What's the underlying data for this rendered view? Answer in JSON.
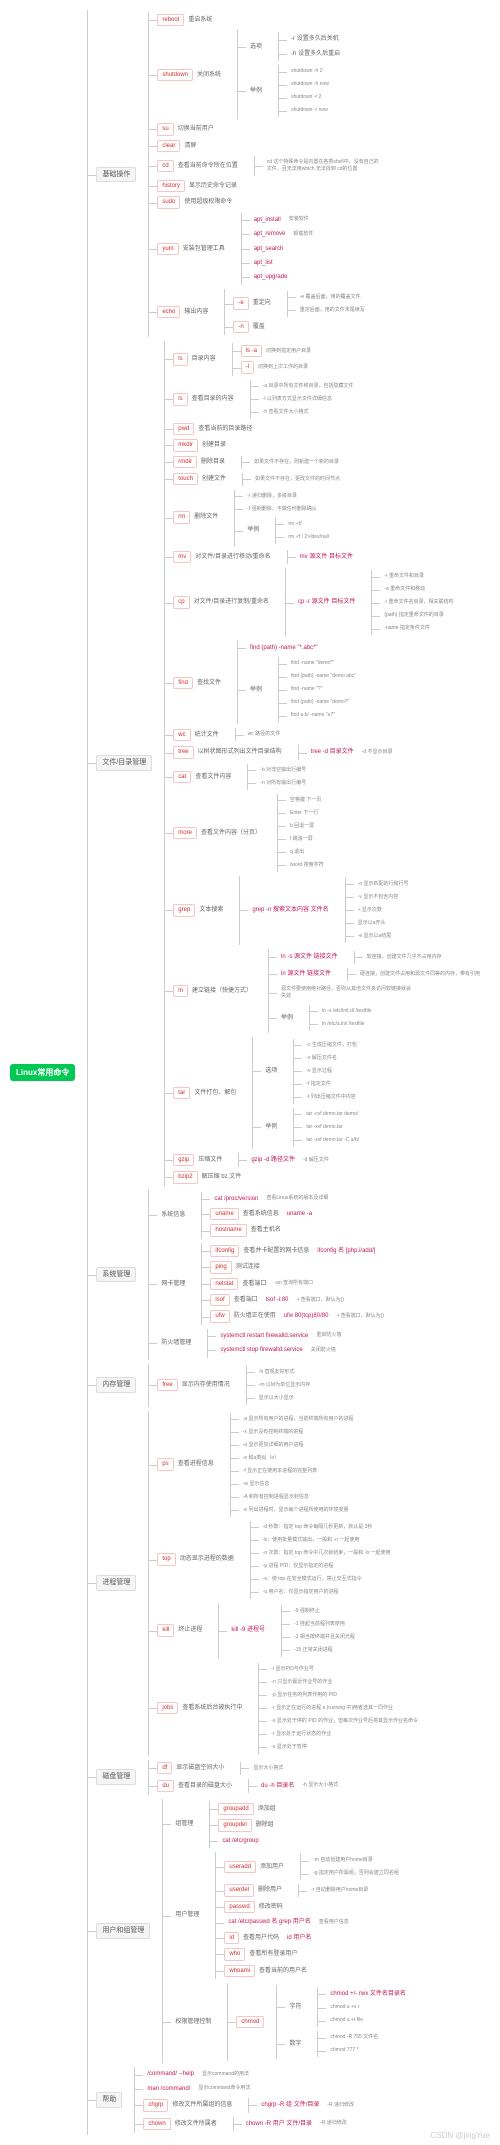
{
  "root": "Linux常用命令",
  "watermark": "CSDN @jingYue.",
  "t": {
    "basic": "基础操作",
    "reboot": "reboot",
    "reboot_d": "重启系统",
    "shutdown": "shutdown",
    "shutdown_d": "关闭系统",
    "shutdown_opt": "选项",
    "shutdown_r": "-r 设置多久后关机",
    "shutdown_h": "-h 设置多久后重启",
    "shutdown_ex": "举例",
    "ex1": "shutdown -h 2",
    "ex2": "shutdown -h now",
    "ex3": "shutdown -r 2",
    "ex4": "shutdown -r now",
    "su": "su",
    "su_d": "切换当前用户",
    "clear": "clear",
    "clear_d": "清屏",
    "cd": "cd",
    "cd_d": "查看当前命令所在位置",
    "cd_note": "cd 这个特殊命令是内置在各类shell中，没有自己的文件，且无法用which 无法找到 cd的位置",
    "history": "history",
    "history_d": "显示历史命令记录",
    "sudo": "sudo",
    "sudo_d": "使用超级权限命令",
    "yum": "yum",
    "yum_d": "安装包管理工具",
    "yum1": "apt_install",
    "yum1_d": "安装软件",
    "yum2": "apt_remove",
    "yum2_d": "卸载软件",
    "yum3": "apt_search",
    "yum4": "apt_list",
    "yum5": "apt_upgrade",
    "echo": "echo",
    "echo_d": "输出内容",
    "echo_opt1": "-e",
    "echo_opt1_d": "重定向",
    "echo_opt2": "-n",
    "echo_opt2_d": "覆盖",
    "echo_note1": "-e 覆盖后面，用的覆盖文件",
    "echo_note2": "重定后面，用的文件末尾续写",
    "file": "文件/目录管理",
    "ls": "ls",
    "ls_d": "目录内容",
    "ls_a": "ls -a",
    "ls_a_d": "切换到指定用户目录",
    "ls_l": "-l",
    "ls_l_d": "切换到上次工作的目录",
    "ls_la": "-a 目录中所有文件和目录，包括隐藏文件",
    "ls_la2": "查看目录的内容",
    "ls_la3": "-l 以列表方式显示文件详细信息",
    "ls_la4": "-h 查看文件大小格式",
    "pwd": "pwd",
    "pwd_d": "查看当前的目录路径",
    "mkdir": "mkdir",
    "mkdir_d": "创建目录",
    "rmdir": "rmdir",
    "rmdir_d": "删除目录",
    "rmdir_note": "如果文件不存在，则新建一个新的目录",
    "touch": "touch",
    "touch_d": "创建文件",
    "touch_note": "如果文件不存在，更改文件的时间节点",
    "rm": "rm",
    "rm_d": "删除文件",
    "rm_r": "-r 递归删除，多级目录",
    "rm_f": "-f 强制删除，不做任何删除确认",
    "rm_ex": "举例",
    "rm_ex1": "rm -rf/",
    "rm_ex2": "rm -rf / 2>/dev/null",
    "mv": "mv",
    "mv_d": "对文件/目录进行移动/重命名",
    "mv_ex": "mv 源文件 目标文件",
    "cp": "cp",
    "cp_d": "对文件/目录进行复制/重命名",
    "cp_ex": "cp -r 源文件 目标文件",
    "cp_n1": "-r 重命文件和目录",
    "cp_n2": "-a 重命文件和移动",
    "cp_n3": "-i 重命文件名目录，相关联结构",
    "cp_n4": "(path) 指定重命文件的目录",
    "cp_n5": "-name 指定条件文件",
    "find": "find",
    "find_d": "查找文件",
    "find_ex1": "find (path) -name \"*.abc*\"",
    "find_ex2": "find -name \"demo*\"",
    "find_ex3": "find (path) -name \"demo abc\"",
    "find_ex4": "find -name \"?\"",
    "find_ex5": "find (path) -name \"demo?\"",
    "find_ex6": "find a.b/ -name \"a?\"",
    "wc": "wc",
    "wc_d": "统计文件",
    "wc_note": "wc 路径的文件",
    "tree": "tree",
    "tree_d": "以树状图形式列出文件目录结构",
    "tree_ex": "tree -d 目录文件",
    "tree_note": "-d 不显示目录",
    "cat": "cat",
    "cat_d": "查看文件内容",
    "cat_n1": "-b 对非空输出行编号",
    "cat_n2": "-n 对所有输出行编号",
    "more": "more",
    "more_d": "查看文件内容（分页）",
    "more_n1": "空格键 下一页",
    "more_n2": "Enter 下一行",
    "more_n3": "b 回退一屏",
    "more_n4": "f 跳滚一屏",
    "more_n5": "q 退出",
    "more_n6": "/word 搜索字符",
    "grep": "grep",
    "grep_d": "文本搜索",
    "grep_ex": "grep -n 搜索文本内容 文件名",
    "grep_n1": "-n 显示匹配的行和行号",
    "grep_n2": "-v 显示不包含内容",
    "grep_n3": "-i 显示次数",
    "grep_n4": "显示以a开头",
    "grep_n5": "-e 显示以a结尾",
    "ln": "ln",
    "ln_d": "建立链接（快捷方式）",
    "ln_ex1": "ln -s 源文件 链接文件",
    "ln_n1": "软连接，创建文件几乎不占用内存",
    "ln_ex2": "ln 源文件 链接文件",
    "ln_n2": "硬连接，创建文件占用和源文件同等的内存，带有引用",
    "ln_note": "源文件要使用绝对路径，否则从其他文件夹访问软链接就会失效",
    "ln_ex3": "ln -s /etc/init.d/ /testfile",
    "ln_ex4": "ln /etc/a.ini/ /testfile",
    "tar": "tar",
    "tar_d": "文件打包、解包",
    "tar_opt": "选项",
    "tar_n1": "-c 生成压缩文件，打包",
    "tar_n2": "-x 解压文件名",
    "tar_n3": "-v 显示过程",
    "tar_n4": "-f 指定文件",
    "tar_n5": "-t 列出压缩文件中内容",
    "tar_ex": "举例",
    "tar_ex1": "tar -cvf demo.tar demo/",
    "tar_ex2": "tar -xvf demo.tar",
    "tar_ex3": "tar -zvf demo.tar -C a/b/",
    "gzip": "gzip",
    "gzip_d": "压缩文件",
    "gzip_ex": "gzip -d 路径文件",
    "gzip_n1": "-d 解压文件",
    "bzip2": "bzip2",
    "bzip2_d": "解压缩 bz 文件",
    "sys": "系统管理",
    "sys_info": "系统信息",
    "cat_proc": "cat /proc/version",
    "cat_proc_d": "查看Linux系统的版本及详细",
    "uname": "uname",
    "uname_d": "查看系统信息",
    "uname_ex": "uname -a",
    "hostname": "hostname",
    "hostname_d": "查看主机名",
    "netcard": "网卡管理",
    "ifconfig": "ifconfig",
    "ifconfig_d": "查看并卡配置的网卡信息",
    "ifconfig_ex": "ifconfig 名 [php.i/add/]",
    "ping": "ping",
    "ping_d": "测试连接",
    "netstat": "netstat",
    "netstat_d": "查看端口",
    "netstat_note": "-an 查询所有端口",
    "lsof": "lsof",
    "lsof_d": "查看端口",
    "lsof_ex": "lsof -i:80",
    "lsof_n1": "-i 查看端口，默认为()",
    "ufw": "ufw",
    "ufw_d": "防火墙正在使用",
    "ufw_ex": "ufw 80(tcp)80/80",
    "ufw_n1": "-i 查看端口，默认为()",
    "fire": "防火墙管理",
    "systemctl": "systemctl restart firewalld.service",
    "systemctl_d": "重启防火墙",
    "systemctl2": "systemctl stop firewalld.service",
    "systemctl2_d": "关闭防火墙",
    "mem": "内存管理",
    "free": "free",
    "free_d": "显示内存使用情况",
    "free_n1": "-h 直观友好形式",
    "free_n2": "-m 以M为单位显示内存",
    "free_n3": "显示以大小显示",
    "proc": "进程管理",
    "ps": "ps",
    "ps_d": "查看进程信息",
    "ps_n1": "-a 显示所有用户的进程，当前终端所有用户的进程",
    "ps_n2": "-x 显示没有控制终端的进程",
    "ps_n3": "-u 显示更加详细的用户进程",
    "ps_n4": "-e 和a类似（e）",
    "ps_n5": "-f 显示正在使用本进程的完整列表",
    "ps_n6": "-w 显示信息",
    "ps_n7": "-A 和所有控制进程显示封信息",
    "ps_n8": "-e 列出进程时，显示每个进程所使用的环境变量",
    "top": "top",
    "top_d": "动态显示进程的数据",
    "top_n1": "-d 秒数：指定 top 命令每隔几秒更新，默认是 3秒",
    "top_n2": "-b：使用批量模式输出，一般和 -n 一起使用",
    "top_n3": "-n 次数：指定 top 命令中几次就结束，一般和 -b 一起使用",
    "top_n4": "-p 进程 PID：仅显示指定的进程",
    "top_n5": "-s：使 top 在安全模式运行，禁止交互式指令",
    "top_n6": "-u 用户名：仅显示指定用户的进程",
    "kill": "kill",
    "kill_d": "终止进程",
    "kill_ex": "kill -9 进程号",
    "kill_n1": "-9 强制终止",
    "kill_n2": "-1 挂起当前程列表使用",
    "kill_n3": "-2 相当按终端并且关闭光程",
    "kill_n4": "-15 正常关闭进程",
    "jobs": "jobs",
    "jobs_d": "查看系统后台被执行中",
    "jobs_n1": "-l 显示PID与作业号",
    "jobs_n2": "-n 只显示最近作业号的作业",
    "jobs_n3": "-p 显示任务的列表作用的 PID",
    "jobs_n4": "-r 显示正在运行的进程 a (running 中)两者选其一同作业",
    "jobs_n5": "-s 显示处于停的 PID 的作业，但每次作业号后将其显示作业名命令",
    "jobs_n6": "-r 显示处于运行状态的作业",
    "jobs_n7": "-s 显示处于暂停",
    "disk": "磁盘管理",
    "df": "df",
    "df_d": "显示磁盘空间大小",
    "df_n1": "显示大小格式",
    "du": "du",
    "du_d": "查看目录的磁盘大小",
    "du_ex": "du -h 目录名",
    "du_n1": "-h 显示大小格式",
    "user": "用户和组管理",
    "group": "组管理",
    "groupadd": "groupadd",
    "groupadd_d": "添加组",
    "groupdel": "groupdel",
    "groupdel_d": "删除组",
    "cat_group": "cat /etc/group",
    "user_mgr": "用户管理",
    "useradd": "useradd",
    "useradd_d": "添加用户",
    "useradd_n1": "-m 自动创建用户home目录",
    "useradd_n2": "-g 指定用户所属组，否则会建立同名组",
    "userdel": "userdel",
    "userdel_d": "删除用户",
    "userdel_n1": "-r 自动删除用户home目录",
    "passwd": "passwd",
    "passwd_d": "修改密码",
    "cat_pwd": "cat /etc/passwd 名 grep 用户名",
    "cat_pwd_d": "查看用户信息",
    "id": "id",
    "id_d": "查看用户代码",
    "id_ex": "id 用户名",
    "who": "who",
    "who_d": "查看所有登录用户",
    "whoami": "whoami",
    "whoami_d": "查看当前的用户名",
    "perm": "权限管理",
    "perm_ctrl": "权限管理控制",
    "chmod": "chmod",
    "chmod_ex": "chmod +/- rwx 文件名目录名",
    "chmod_char": "字符",
    "chmod_num": "数字",
    "chmod_n1": "chmod -R 755 文件名",
    "chmod_n2": "chmod 777 *",
    "chmod_n3": "chmod u +x r",
    "chmod_n4": "chmod u +t file",
    "help": "帮助",
    "help_cmd": "/command/ --help",
    "help_cmd_d": "显示command的用法",
    "man_cmd": "man /command/",
    "man_cmd_d": "显示command命令用法",
    "chgrp": "chgrp",
    "chgrp_d": "修改文件所属组的信息",
    "chgrp_ex": "chgrp -R 组 文件/目录",
    "chgrp_n1": "-R 递归修改",
    "chown": "chown",
    "chown_d": "修改文件所属者",
    "chown_ex": "chown -R 用户 文件/目录",
    "chown_n1": "-R 递归修改"
  }
}
